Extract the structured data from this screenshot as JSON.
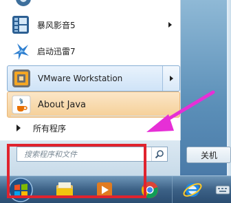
{
  "start_menu": {
    "items": [
      {
        "label": "暴风影音5",
        "icon": "baofeng-icon",
        "has_submenu": true
      },
      {
        "label": "启动迅雷7",
        "icon": "thunder-bird-icon",
        "has_submenu": false
      },
      {
        "label": "VMware Workstation",
        "icon": "vmware-icon",
        "has_submenu": true
      },
      {
        "label": "About Java",
        "icon": "java-icon",
        "has_submenu": false
      }
    ],
    "all_programs_label": "所有程序",
    "search": {
      "placeholder": "搜索程序和文件"
    },
    "shutdown_label": "关机"
  },
  "taskbar": {
    "items": [
      "start-orb-icon",
      "file-explorer-icon",
      "media-player-icon",
      "chrome-icon",
      "internet-explorer-icon",
      "keyboard-icon"
    ]
  },
  "annotation": {
    "highlight_color": "#e0232e",
    "arrow_color": "#e62fd6"
  }
}
